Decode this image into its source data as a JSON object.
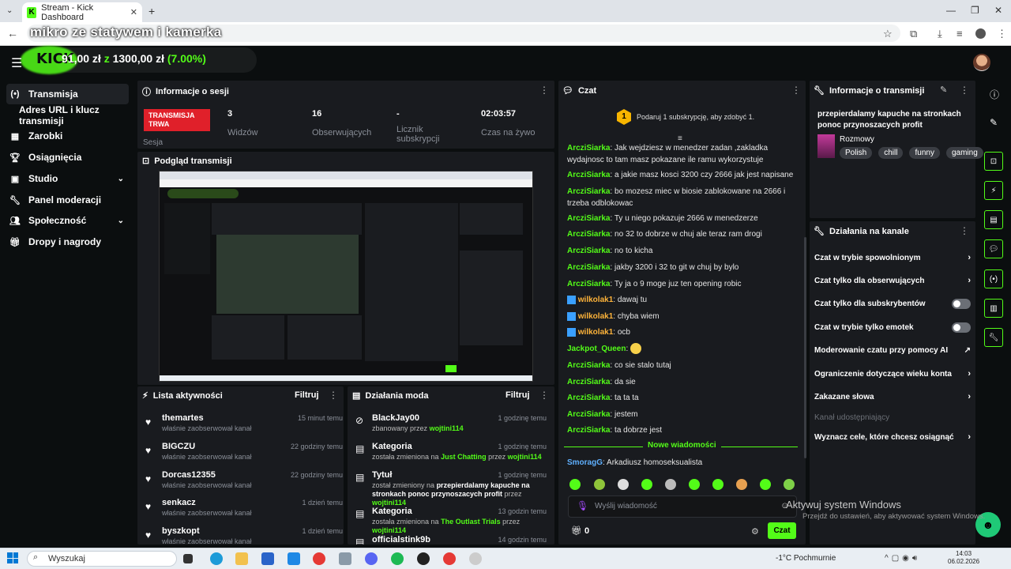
{
  "browser": {
    "tab_title": "Stream - Kick Dashboard",
    "overlay_text": "mikro ze statywem i kamerka"
  },
  "header": {
    "goal_current": "91,00 zł",
    "goal_sep": "z",
    "goal_target": "1300,00 zł",
    "goal_percent": "(7.00%)",
    "goal_progress": 0.07
  },
  "sidebar": {
    "items": [
      {
        "label": "Transmisja",
        "icon": "broadcast-icon"
      },
      {
        "label": "Adres URL i klucz transmisji",
        "icon": ""
      },
      {
        "label": "Zarobki",
        "icon": "earnings-icon"
      },
      {
        "label": "Osiągnięcia",
        "icon": "trophy-icon"
      },
      {
        "label": "Studio",
        "icon": "studio-icon"
      },
      {
        "label": "Panel moderacji",
        "icon": "wrench-icon"
      },
      {
        "label": "Społeczność",
        "icon": "community-icon"
      },
      {
        "label": "Dropy i nagrody",
        "icon": "gift-icon"
      }
    ]
  },
  "session": {
    "title": "Informacje o sesji",
    "badge": "TRANSMISJA TRWA",
    "badge_sub": "Sesja",
    "stats": [
      {
        "value": "3",
        "label": "Widzów"
      },
      {
        "value": "16",
        "label": "Obserwujących"
      },
      {
        "value": "-",
        "label": "Licznik subskrypcji"
      },
      {
        "value": "02:03:57",
        "label": "Czas na żywo"
      }
    ]
  },
  "preview": {
    "title": "Podgląd transmisji"
  },
  "activity": {
    "title": "Lista aktywności",
    "filter": "Filtruj",
    "items": [
      {
        "name": "themartes",
        "sub": "właśnie zaobserwował kanał",
        "time": "15 minut temu"
      },
      {
        "name": "BIGCZU",
        "sub": "właśnie zaobserwował kanał",
        "time": "22 godziny temu"
      },
      {
        "name": "Dorcas12355",
        "sub": "właśnie zaobserwował kanał",
        "time": "22 godziny temu"
      },
      {
        "name": "senkacz",
        "sub": "właśnie zaobserwował kanał",
        "time": "1 dzień temu"
      },
      {
        "name": "byszkopt",
        "sub": "właśnie zaobserwował kanał",
        "time": "1 dzień temu"
      }
    ]
  },
  "mod_actions": {
    "title": "Działania moda",
    "filter": "Filtruj",
    "items": [
      {
        "name": "BlackJay00",
        "sub1": "zbanowany przez",
        "sub2": "",
        "who": "wojtini114",
        "extra": "",
        "time": "1 godzinę temu"
      },
      {
        "name": "Kategoria",
        "sub1": "została zmieniona na",
        "sub2": "Just Chatting",
        "who": "wojtini114",
        "extra": "przez",
        "time": "1 godzinę temu"
      },
      {
        "name": "Tytuł",
        "sub1": "został zmieniony na",
        "sub2": "przepierdalamy kapuche na stronkach ponoc przynoszacych profit",
        "who": "wojtini114",
        "extra": "przez",
        "time": "1 godzinę temu"
      },
      {
        "name": "Kategoria",
        "sub1": "została zmieniona na",
        "sub2": "The Outlast Trials",
        "who": "wojtini114",
        "extra": "przez",
        "time": "13 godzin temu"
      },
      {
        "name": "officialstink9b",
        "sub1": "",
        "sub2": "",
        "who": "",
        "extra": "",
        "time": "14 godzin temu"
      }
    ]
  },
  "chat": {
    "title": "Czat",
    "sub_prompt": "Podaruj 1 subskrypcję, aby zdobyć 1.",
    "sub_icon_text": "1",
    "messages": [
      {
        "user": "ArcziSiarka",
        "text": "Jak wejdziesz w menedzer zadan ,zakladka wydajnosc to tam masz pokazane ile ramu wykorzystuje"
      },
      {
        "user": "ArcziSiarka",
        "text": "a jakie masz kosci 3200 czy 2666 jak jest napisane"
      },
      {
        "user": "ArcziSiarka",
        "text": "bo mozesz miec w biosie zablokowane na 2666 i trzeba odblokowac"
      },
      {
        "user": "ArcziSiarka",
        "text": "Ty u niego pokazuje 2666 w menedzerze"
      },
      {
        "user": "ArcziSiarka",
        "text": "no 32 to dobrze w chuj ale teraz ram drogi"
      },
      {
        "user": "ArcziSiarka",
        "text": "no to kicha"
      },
      {
        "user": "ArcziSiarka",
        "text": "jakby 3200 i 32 to git w chuj by bylo"
      },
      {
        "user": "ArcziSiarka",
        "text": "Ty ja o 9 moge juz ten opening robic"
      },
      {
        "user": "wilkolak1",
        "text": "dawaj tu"
      },
      {
        "user": "wilkolak1",
        "text": "chyba wiem"
      },
      {
        "user": "wilkolak1",
        "text": "ocb"
      },
      {
        "user": "Jackpot_Queen",
        "text": ""
      },
      {
        "user": "ArcziSiarka",
        "text": "co sie stalo tutaj"
      },
      {
        "user": "ArcziSiarka",
        "text": "da sie"
      },
      {
        "user": "ArcziSiarka",
        "text": "ta ta ta"
      },
      {
        "user": "ArcziSiarka",
        "text": "jestem"
      },
      {
        "user": "ArcziSiarka",
        "text": "ta dobrze jest"
      }
    ],
    "new_messages": "Nowe wiadomości",
    "last_message": {
      "user": "SmoragG",
      "text": "Arkadiusz homoseksualista"
    },
    "input_placeholder": "Wyślij wiadomość",
    "points": "0",
    "send": "Czat"
  },
  "stream_info": {
    "title": "Informacje o transmisji",
    "stream_title": "przepierdalamy kapuche na stronkach ponoc przynoszacych profit",
    "category": "Rozmowy",
    "tags": [
      "Polish",
      "chill",
      "funny",
      "gaming"
    ]
  },
  "channel_actions": {
    "title": "Działania na kanale",
    "items": [
      {
        "label": "Czat w trybie spowolnionym",
        "control": "chevron"
      },
      {
        "label": "Czat tylko dla obserwujących",
        "control": "chevron"
      },
      {
        "label": "Czat tylko dla subskrybentów",
        "control": "toggle"
      },
      {
        "label": "Czat w trybie tylko emotek",
        "control": "toggle"
      },
      {
        "label": "Moderowanie czatu przy pomocy AI",
        "control": "external"
      },
      {
        "label": "Ograniczenie dotyczące wieku konta",
        "control": "chevron"
      },
      {
        "label": "Zakazane słowa",
        "control": "chevron"
      },
      {
        "label": "Kanał udostępniający",
        "control": "none"
      },
      {
        "label": "Wyznacz cele, które chcesz osiągnąć",
        "control": "chevron"
      }
    ]
  },
  "watermark": {
    "line1": "Aktywuj system Windows",
    "line2": "Przejdź do ustawień, aby aktywować system Windows."
  },
  "taskbar": {
    "search": "Wyszukaj",
    "weather": "-1°C  Pochmurnie",
    "time": "14:03",
    "date": "06.02.2026"
  }
}
